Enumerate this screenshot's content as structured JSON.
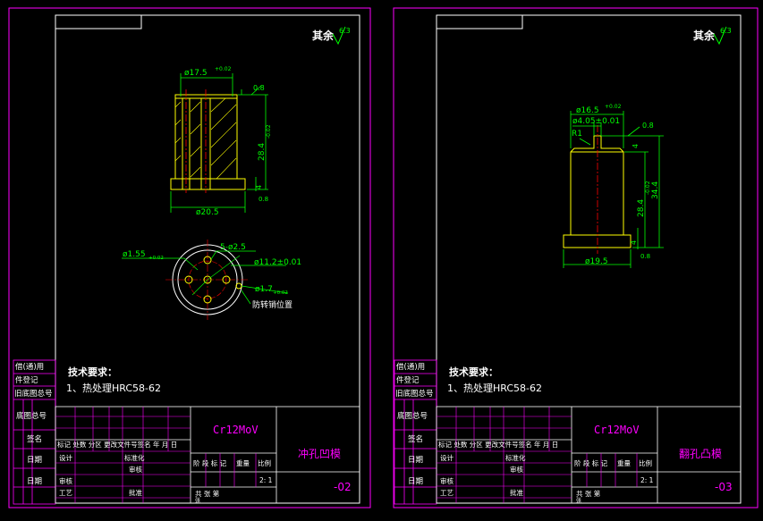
{
  "colors": {
    "background": "#000000",
    "sheet_border": "#ff00ff",
    "frame": "#ffffff",
    "table_lines": "#ff00ff",
    "dimension": "#00ff00",
    "part_outline": "#ffff00",
    "center_line": "#ff0000",
    "text_white": "#ffffff",
    "text_green": "#00ff00",
    "text_magenta": "#ff00ff",
    "text_yellow": "#ffff00"
  },
  "sheets": [
    {
      "id": "left",
      "roughness_note": "其余",
      "roughness_value": "6.3",
      "tech_title": "技术要求：",
      "tech_item": "1、热处理HRC58-62",
      "side_labels": [
        "借(通)用",
        "件登记",
        "旧底图总号",
        "底图总号",
        "签名",
        "日期",
        "日期"
      ],
      "material": "Cr12MoV",
      "part_name": "冲孔凹模",
      "drawing_no": "-02",
      "scale": "2: 1",
      "table_labels": {
        "revision_row": "标记 处数 分区 更改文件号签名 年 月 日",
        "design": "设计",
        "standardize": "标准化",
        "review": "审核",
        "process": "工艺",
        "approve": "批准",
        "check": "审核",
        "stage_marks": "阶 段 标 记",
        "weight": "重量",
        "ratio": "比例",
        "sheet_total": "共    张    第",
        "sheet_unit": "张"
      },
      "dims": {
        "top_dia": "ø17.5",
        "top_tol": "+0.02",
        "bottom_dia": "ø20.5",
        "height": "28.4",
        "height_tol": "-0.02",
        "flatness": "0.8",
        "step": "4",
        "chamfer": "0.8",
        "small_hole": "ø1.55",
        "small_hole_tol": "+0.02",
        "holes": "5-ø2.5",
        "pcd": "ø11.2±0.01",
        "pin_hole": "ø1.7",
        "pin_tol": "+0.02",
        "pin_note": "防转销位置"
      }
    },
    {
      "id": "right",
      "roughness_note": "其余",
      "roughness_value": "6.3",
      "tech_title": "技术要求：",
      "tech_item": "1、热处理HRC58-62",
      "side_labels": [
        "借(通)用",
        "件登记",
        "旧底图总号",
        "底图总号",
        "签名",
        "日期",
        "日期"
      ],
      "material": "Cr12MoV",
      "part_name": "翻孔凸模",
      "drawing_no": "-03",
      "scale": "2: 1",
      "table_labels": {
        "revision_row": "标记 处数 分区 更改文件号签名 年 月 日",
        "design": "设计",
        "standardize": "标准化",
        "review": "审核",
        "process": "工艺",
        "approve": "批准",
        "check": "审核",
        "stage_marks": "阶 段 标 记",
        "weight": "重量",
        "ratio": "比例",
        "sheet_total": "共    张    第",
        "sheet_unit": "张"
      },
      "dims": {
        "top_dia": "ø16.5",
        "top_tol": "+0.02",
        "tip_dia": "ø4.05±0.01",
        "radius": "R1",
        "flatness": "0.8",
        "step": "4",
        "height": "28.4",
        "height_tol": "-0.02",
        "total": "34.4",
        "bottom_dia": "ø19.5",
        "chamfer": "0.8"
      }
    }
  ]
}
